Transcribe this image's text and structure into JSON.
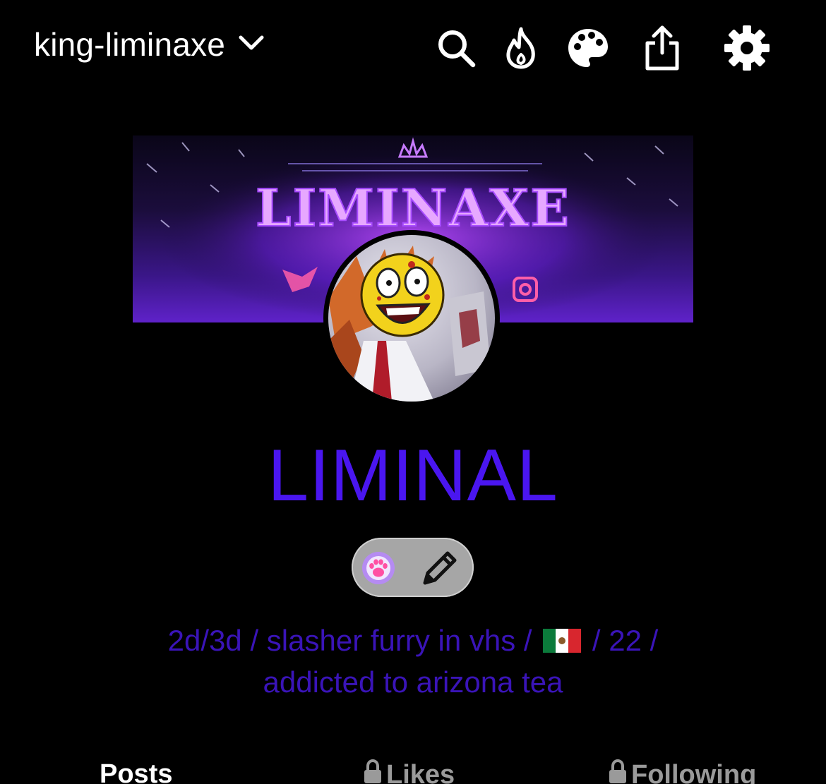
{
  "topbar": {
    "blog_name": "king-liminaxe",
    "icons": [
      "chevron-down-icon",
      "search-icon",
      "flame-icon",
      "palette-icon",
      "share-icon",
      "gear-icon"
    ]
  },
  "header": {
    "logo_text": "LIMINAXE"
  },
  "profile": {
    "title": "LIMINAL",
    "description_line1_a": "2d/3d / slasher furry in vhs /",
    "description_line1_b": "/ 22 /",
    "description_line2": "addicted to arizona tea",
    "flag": "mexico-flag-icon"
  },
  "tabs": [
    {
      "label": "Posts",
      "locked": false
    },
    {
      "label": "Likes",
      "locked": true
    },
    {
      "label": "Following",
      "locked": true
    }
  ],
  "colors": {
    "title": "#4a16f0",
    "description": "#3a14b8",
    "background": "#000000",
    "pill": "#a6a6a6"
  }
}
